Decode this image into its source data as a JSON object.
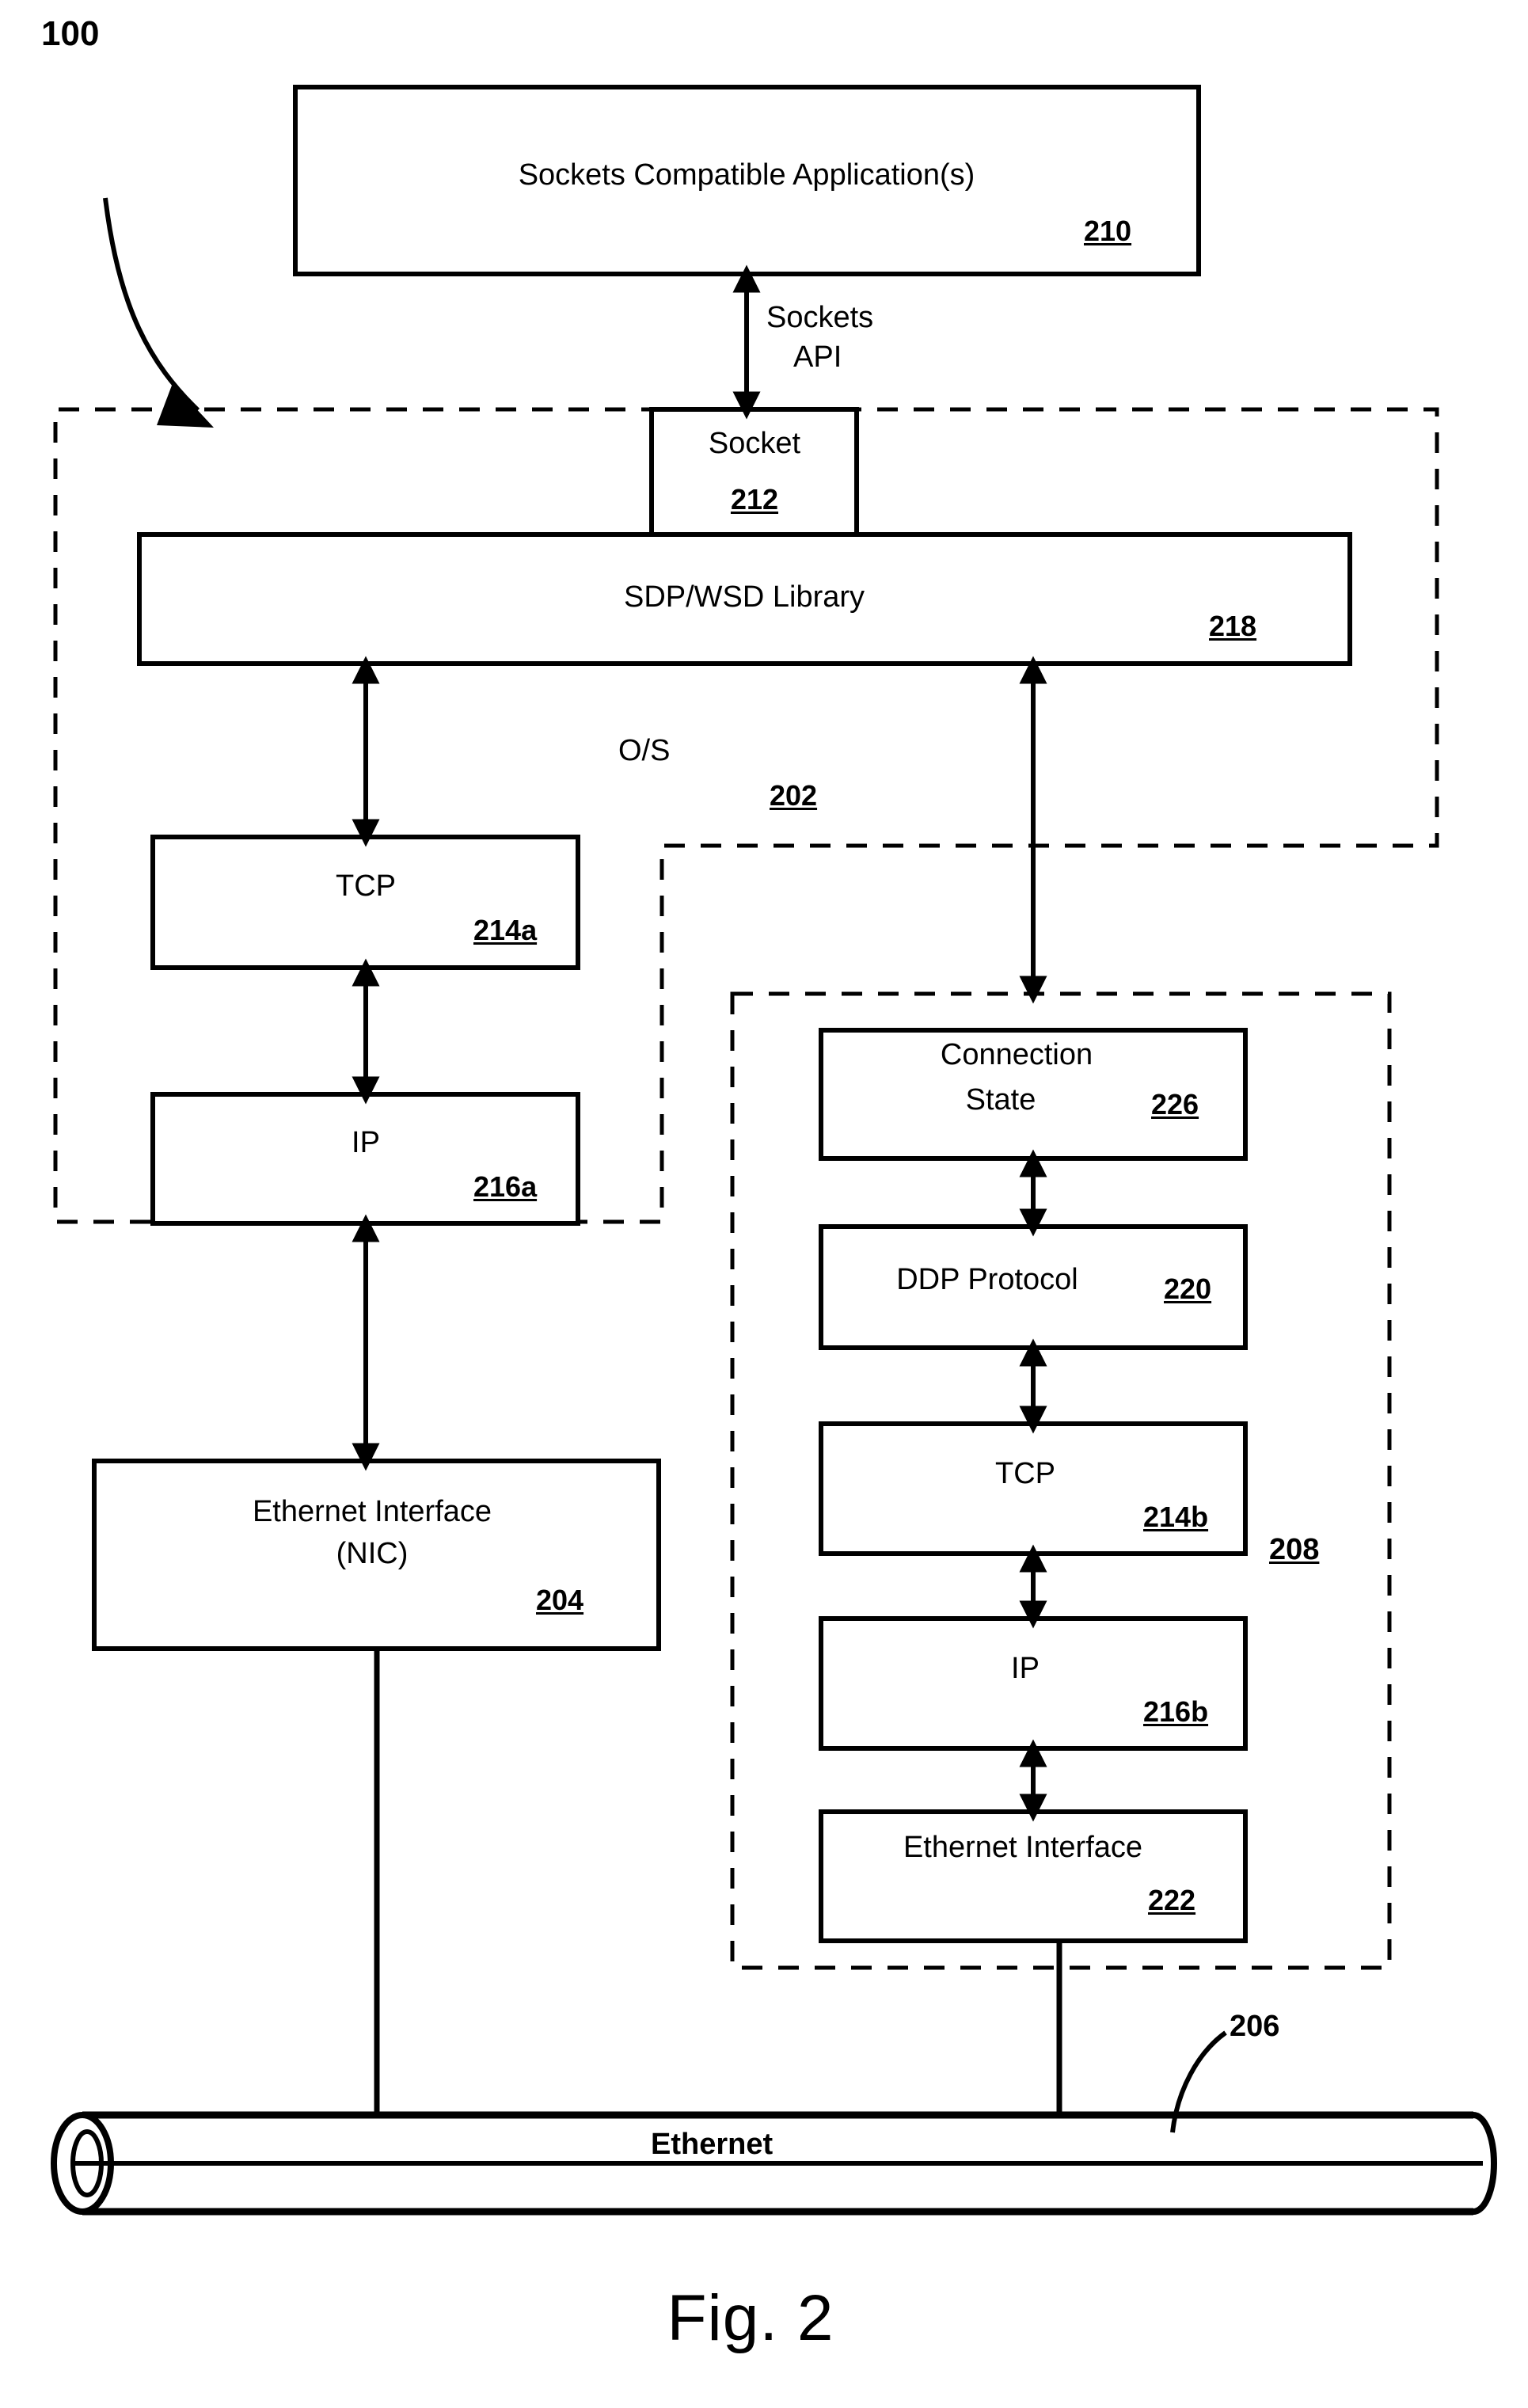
{
  "figure": {
    "caption": "Fig. 2",
    "system_ref": "100"
  },
  "boxes": {
    "application": {
      "label": "Sockets Compatible Application(s)",
      "ref": "210"
    },
    "socket": {
      "label": "Socket",
      "ref": "212"
    },
    "library": {
      "label": "SDP/WSD Library",
      "ref": "218"
    },
    "tcp_host": {
      "label": "TCP",
      "ref": "214a"
    },
    "ip_host": {
      "label": "IP",
      "ref": "216a"
    },
    "nic": {
      "label_line1": "Ethernet Interface",
      "label_line2": "(NIC)",
      "ref": "204"
    },
    "connection_state": {
      "label_line1": "Connection",
      "label_line2": "State",
      "ref": "226"
    },
    "ddp": {
      "label": "DDP Protocol",
      "ref": "220"
    },
    "tcp_offload": {
      "label": "TCP",
      "ref": "214b"
    },
    "ip_offload": {
      "label": "IP",
      "ref": "216b"
    },
    "ethernet_interface_offload": {
      "label": "Ethernet Interface",
      "ref": "222"
    }
  },
  "regions": {
    "os": {
      "label": "O/S",
      "ref": "202"
    },
    "offload_engine": {
      "ref": "208"
    }
  },
  "connectors": {
    "sockets_api": {
      "label_line1": "Sockets",
      "label_line2": "API"
    }
  },
  "bus": {
    "label": "Ethernet",
    "ref": "206"
  },
  "colors": {
    "ink": "#000000",
    "paper": "#ffffff"
  }
}
